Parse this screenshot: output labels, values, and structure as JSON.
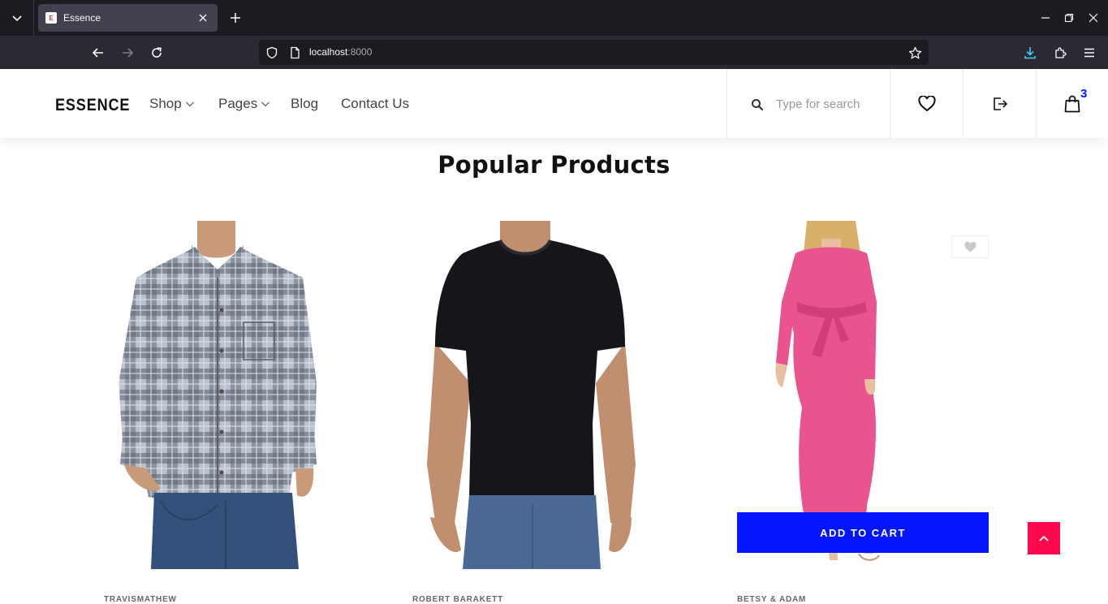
{
  "browser": {
    "tab_title": "Essence",
    "favicon_letter": "E",
    "url_host": "localhost",
    "url_port": ":8000"
  },
  "header": {
    "logo": "ESSENCE",
    "menu": [
      {
        "label": "Shop",
        "has_dropdown": true
      },
      {
        "label": "Pages",
        "has_dropdown": true
      },
      {
        "label": "Blog",
        "has_dropdown": false
      },
      {
        "label": "Contact Us",
        "has_dropdown": false
      }
    ],
    "search_placeholder": "Type for search",
    "cart_count": "3"
  },
  "section": {
    "title": "Popular Products"
  },
  "products": [
    {
      "brand": "TRAVISMATHEW",
      "image_desc": "gray-plaid-shirt",
      "image_alt": "Gray plaid button-down shirt"
    },
    {
      "brand": "ROBERT BARAKETT",
      "image_desc": "black-tshirt",
      "image_alt": "Black crew-neck t-shirt"
    },
    {
      "brand": "BETSY & ADAM",
      "image_desc": "pink-dress",
      "image_alt": "Pink tie-waist dress",
      "hovered": true
    }
  ],
  "product_actions": {
    "add_to_cart": "ADD TO CART"
  },
  "colors": {
    "accent_blue": "#0315ff",
    "back_to_top": "#ff084e"
  }
}
